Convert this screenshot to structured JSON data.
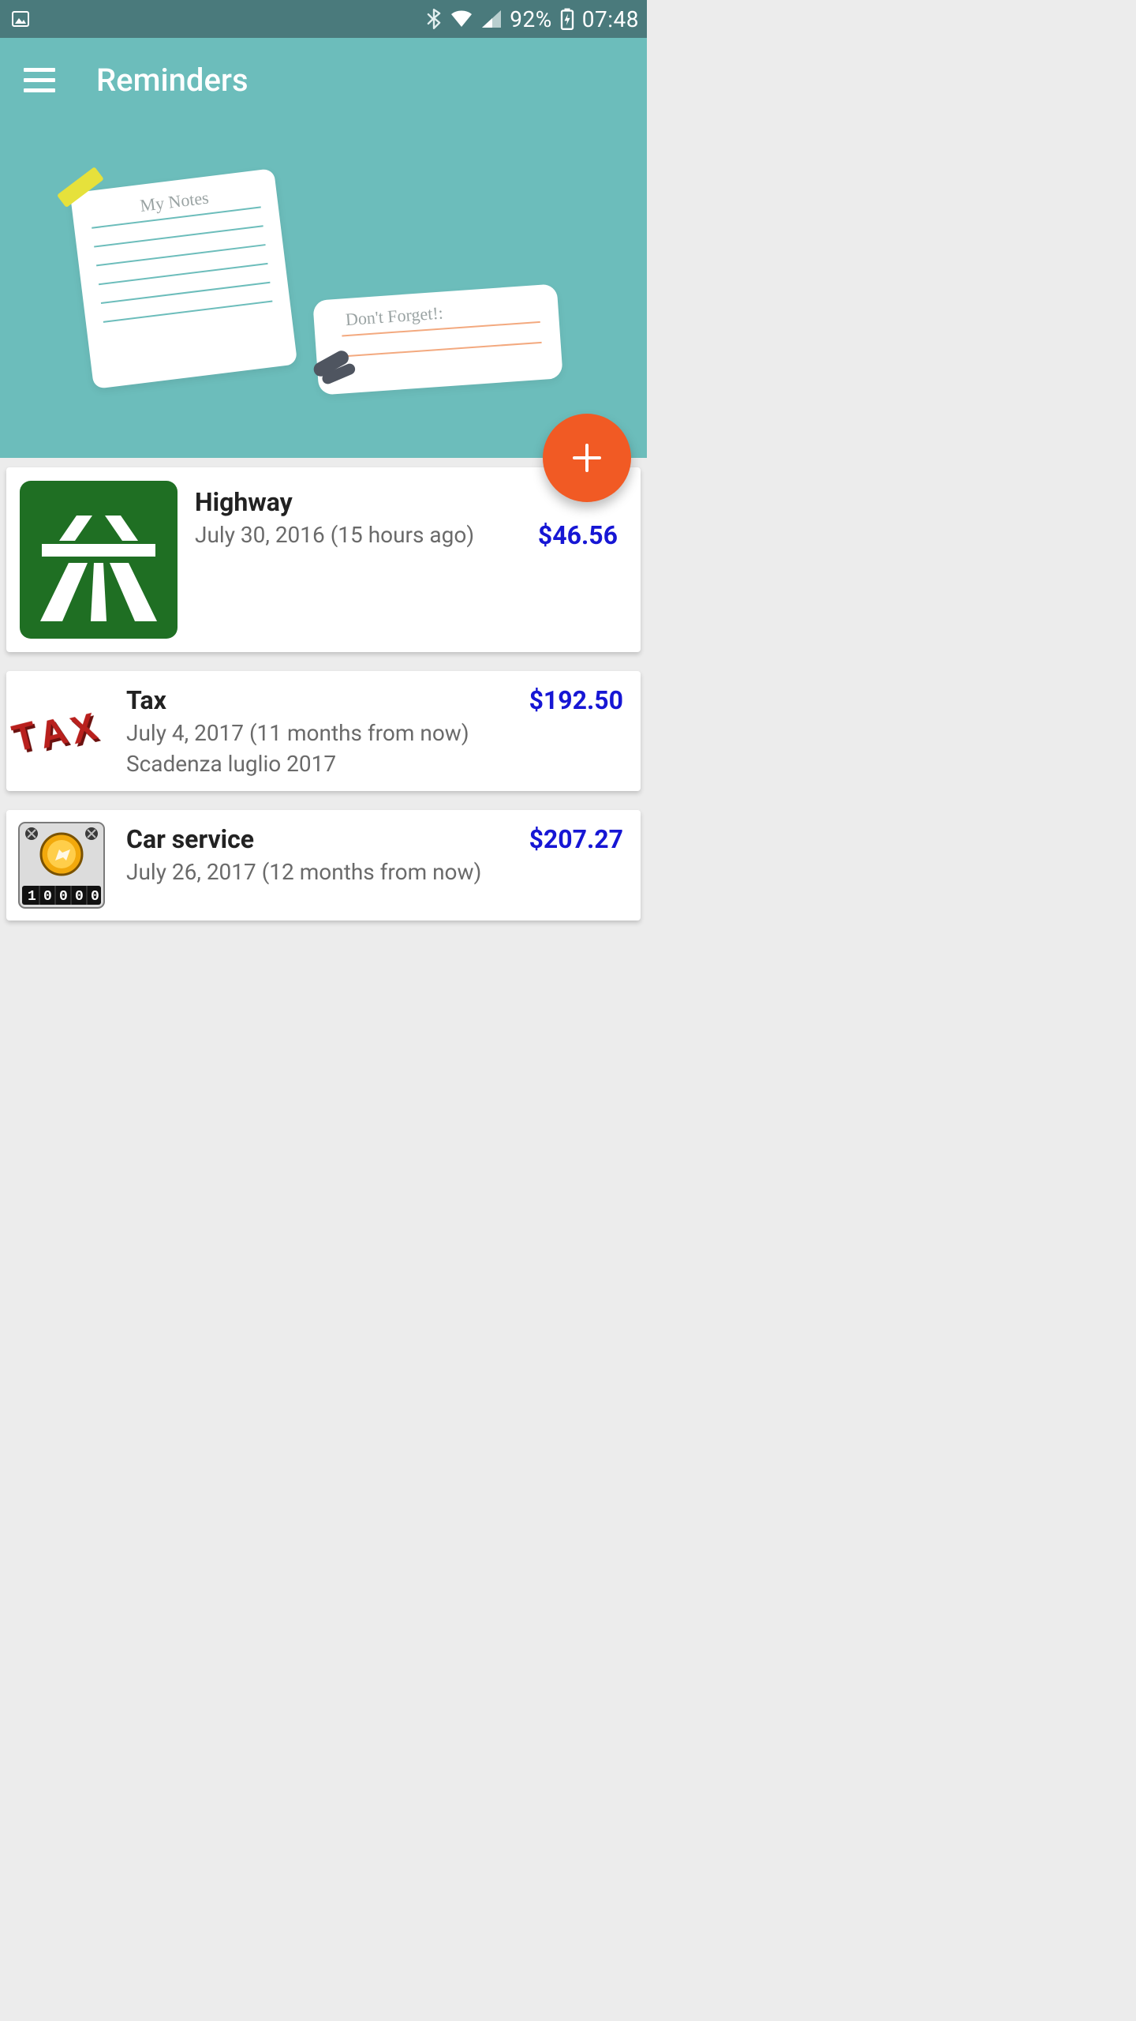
{
  "status_bar": {
    "battery_pct": "92%",
    "time": "07:48"
  },
  "header": {
    "title": "Reminders",
    "note1_label": "My Notes",
    "note2_label": "Don't Forget!:"
  },
  "fab": {
    "label_aria": "Add reminder"
  },
  "reminders": [
    {
      "icon": "highway",
      "title": "Highway",
      "subtitle": "July 30, 2016 (15 hours ago)",
      "note": "",
      "price": "$46.56"
    },
    {
      "icon": "tax",
      "title": "Tax",
      "subtitle": "July 4, 2017 (11 months from now)",
      "note": "Scadenza luglio 2017",
      "price": "$192.50"
    },
    {
      "icon": "car-service",
      "title": "Car service",
      "subtitle": "July 26, 2017 (12 months from now)",
      "note": "",
      "price": "$207.27"
    }
  ],
  "colors": {
    "status_bar": "#4a7a7c",
    "header_bg": "#6cbdbb",
    "fab": "#f15a24",
    "price": "#1616d4",
    "highway_green": "#1f6f23",
    "tax_red": "#b9201d"
  }
}
